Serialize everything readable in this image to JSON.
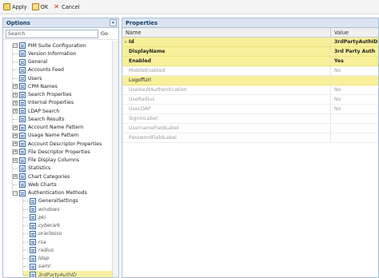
{
  "toolbar": {
    "apply": "Apply",
    "ok": "OK",
    "cancel": "Cancel"
  },
  "left_panel": {
    "title": "Options",
    "collapse_glyph": "«",
    "search": {
      "value": "Search",
      "placeholder": "Search"
    },
    "go": "Go",
    "tree": [
      {
        "label": "PIM Suite Configuration",
        "expander": "−"
      },
      {
        "label": "Version Information"
      },
      {
        "label": "General"
      },
      {
        "label": "Accounts Feed"
      },
      {
        "label": "Users"
      },
      {
        "label": "CPM Names",
        "expander": "+"
      },
      {
        "label": "Search Properties",
        "expander": "+"
      },
      {
        "label": "Internal Properties",
        "expander": "+"
      },
      {
        "label": "LDAP Search",
        "expander": "+"
      },
      {
        "label": "Search Results"
      },
      {
        "label": "Account Name Pattern",
        "expander": "+"
      },
      {
        "label": "Usage Name Pattern",
        "expander": "+"
      },
      {
        "label": "Account Descriptor Properties",
        "expander": "+"
      },
      {
        "label": "File Descriptor Properties",
        "expander": "+"
      },
      {
        "label": "File Display Columns",
        "expander": "+"
      },
      {
        "label": "Statistics"
      },
      {
        "label": "Chart Categories",
        "expander": "+"
      },
      {
        "label": "Web Charts"
      },
      {
        "label": "Authentication Methods",
        "expander": "−"
      },
      {
        "label": "GeneralSettings"
      },
      {
        "label": "windows"
      },
      {
        "label": "pki"
      },
      {
        "label": "cyberark"
      },
      {
        "label": "oraclesso"
      },
      {
        "label": "rsa"
      },
      {
        "label": "radius"
      },
      {
        "label": "ldap"
      },
      {
        "label": "saml"
      },
      {
        "label": "3rdPartyAuthID"
      }
    ]
  },
  "right_panel": {
    "title": "Properties",
    "columns": {
      "name": "Name",
      "value": "Value"
    },
    "rows": [
      {
        "name": "Id",
        "value": "3rdPartyAuthID",
        "marker": "+"
      },
      {
        "name": "DisplayName",
        "value": "3rd Party Auth"
      },
      {
        "name": "Enabled",
        "value": "Yes"
      },
      {
        "name": "MobileEnabled",
        "value": "No"
      },
      {
        "name": "LogoffUrl",
        "value": ""
      },
      {
        "name": "UseVaultAuthentication",
        "value": "No"
      },
      {
        "name": "UseRadius",
        "value": "No"
      },
      {
        "name": "UseLDAP",
        "value": "No"
      },
      {
        "name": "SignInLabel",
        "value": ""
      },
      {
        "name": "UsernameFieldLabel",
        "value": ""
      },
      {
        "name": "PasswordFieldLabel",
        "value": ""
      }
    ]
  }
}
